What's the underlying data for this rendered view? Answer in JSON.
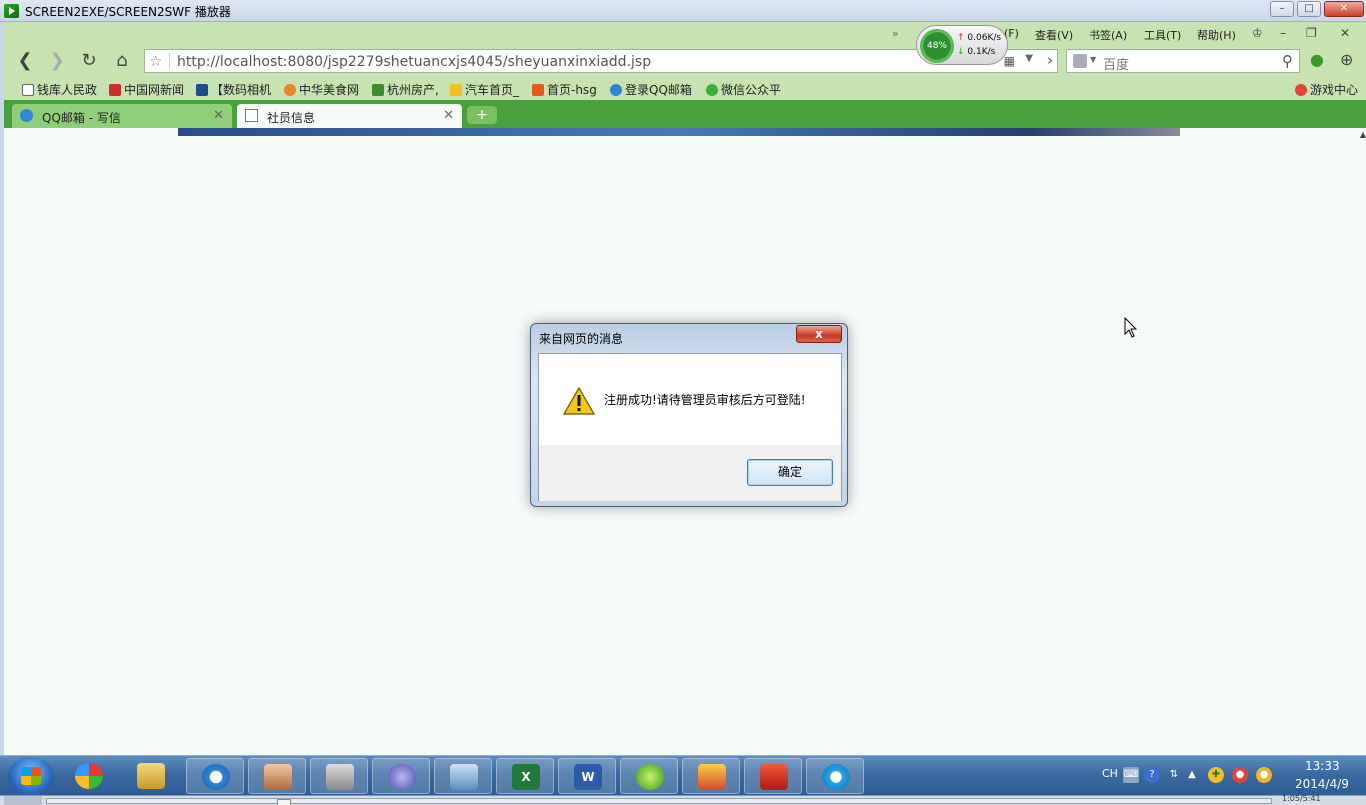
{
  "player": {
    "title": "SCREEN2EXE/SCREEN2SWF 播放器",
    "playback_time": "1:05/5:41",
    "playback_progress": 0.19
  },
  "browser": {
    "menu": {
      "file": "(F)",
      "view": "查看(V)",
      "bookmarks": "书签(A)",
      "tools": "工具(T)",
      "help": "帮助(H)",
      "overflow": "»"
    },
    "net_widget": {
      "cpu": "48%",
      "upload": "0.06K/s",
      "download": "0.1K/s"
    },
    "address": {
      "url": "http://localhost:8080/jsp2279shetuancxjs4045/sheyuanxinxiadd.jsp"
    },
    "search": {
      "placeholder": "百度"
    },
    "bookmarks": [
      {
        "label": "钱库人民政",
        "color": "#ffffff"
      },
      {
        "label": "中国网新闻",
        "color": "#d12b2b"
      },
      {
        "label": "【数码相机",
        "color": "#1d4c8c"
      },
      {
        "label": "中华美食网",
        "color": "#e8872a"
      },
      {
        "label": "杭州房产,",
        "color": "#3b8c2a"
      },
      {
        "label": "汽车首页_",
        "color": "#f2c01f"
      },
      {
        "label": "首页-hsg",
        "color": "#e35a1f"
      },
      {
        "label": "登录QQ邮箱",
        "color": "#2f86d6"
      },
      {
        "label": "微信公众平",
        "color": "#3bb03b"
      }
    ],
    "games": "游戏中心",
    "tabs": [
      {
        "label": "QQ邮箱 - 写信",
        "active": false
      },
      {
        "label": "社员信息",
        "active": true
      }
    ],
    "new_tab": "+"
  },
  "dialog": {
    "title": "来自网页的消息",
    "close": "x",
    "message": "注册成功!请待管理员审核后方可登陆!",
    "ok_label": "确定",
    "icon": "warning-icon"
  },
  "taskbar": {
    "apps": [
      "start-orb",
      "ball-app",
      "file-explorer",
      "qq-browser",
      "contacts",
      "tools",
      "dreamweaver",
      "ftp-client",
      "excel",
      "word",
      "aptana",
      "game",
      "red-app",
      "baidu-cloud"
    ],
    "tray": {
      "lang": "CH",
      "time": "13:33",
      "date": "2014/4/9"
    }
  }
}
